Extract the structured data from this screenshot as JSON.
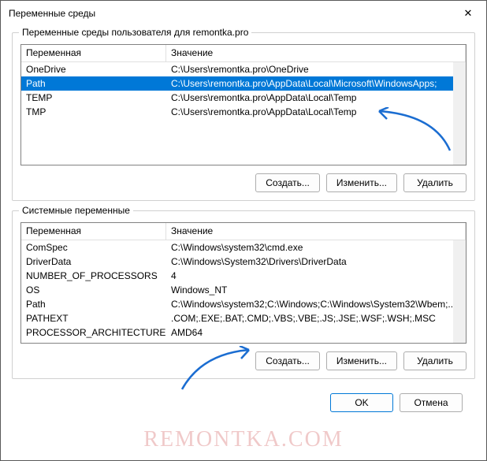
{
  "window": {
    "title": "Переменные среды"
  },
  "user_section": {
    "label": "Переменные среды пользователя для remontka.pro",
    "columns": {
      "var": "Переменная",
      "val": "Значение"
    },
    "rows": [
      {
        "name": "OneDrive",
        "value": "C:\\Users\\remontka.pro\\OneDrive",
        "selected": false
      },
      {
        "name": "Path",
        "value": "C:\\Users\\remontka.pro\\AppData\\Local\\Microsoft\\WindowsApps;",
        "selected": true
      },
      {
        "name": "TEMP",
        "value": "C:\\Users\\remontka.pro\\AppData\\Local\\Temp",
        "selected": false
      },
      {
        "name": "TMP",
        "value": "C:\\Users\\remontka.pro\\AppData\\Local\\Temp",
        "selected": false
      }
    ],
    "buttons": {
      "create": "Создать...",
      "edit": "Изменить...",
      "delete": "Удалить"
    }
  },
  "system_section": {
    "label": "Системные переменные",
    "columns": {
      "var": "Переменная",
      "val": "Значение"
    },
    "rows": [
      {
        "name": "ComSpec",
        "value": "C:\\Windows\\system32\\cmd.exe"
      },
      {
        "name": "DriverData",
        "value": "C:\\Windows\\System32\\Drivers\\DriverData"
      },
      {
        "name": "NUMBER_OF_PROCESSORS",
        "value": "4"
      },
      {
        "name": "OS",
        "value": "Windows_NT"
      },
      {
        "name": "Path",
        "value": "C:\\Windows\\system32;C:\\Windows;C:\\Windows\\System32\\Wbem;..."
      },
      {
        "name": "PATHEXT",
        "value": ".COM;.EXE;.BAT;.CMD;.VBS;.VBE;.JS;.JSE;.WSF;.WSH;.MSC"
      },
      {
        "name": "PROCESSOR_ARCHITECTURE",
        "value": "AMD64"
      }
    ],
    "buttons": {
      "create": "Создать...",
      "edit": "Изменить...",
      "delete": "Удалить"
    }
  },
  "dialog_buttons": {
    "ok": "OK",
    "cancel": "Отмена"
  },
  "watermark": "REMONTKA.COM",
  "arrow_color": "#1b6dd1"
}
